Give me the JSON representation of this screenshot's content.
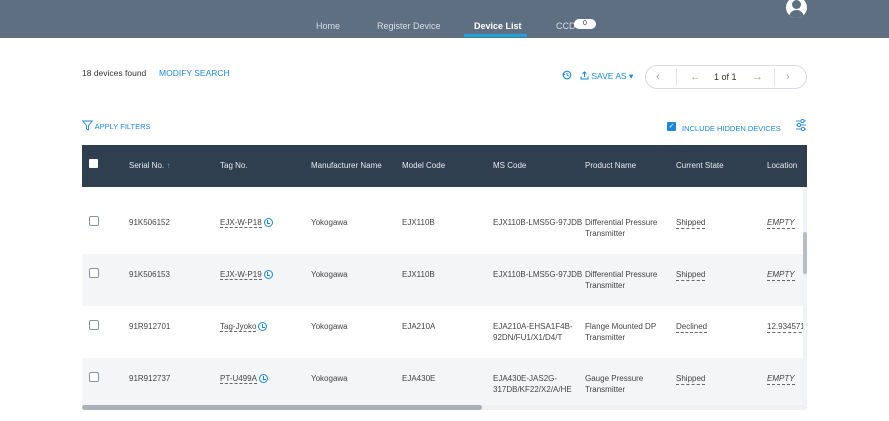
{
  "nav": {
    "home": "Home",
    "register": "Register Device",
    "device_list": "Device List",
    "ccd": "CCD",
    "ccd_count": "0"
  },
  "summary": {
    "count_text": "18 devices found",
    "modify_search": "MODIFY SEARCH"
  },
  "toolbar": {
    "save_as": "SAVE AS",
    "apply_filters": "APPLY FILTERS",
    "include_hidden": "INCLUDE HIDDEN DEVICES"
  },
  "pagination": {
    "label": "1 of 1"
  },
  "table": {
    "headers": {
      "serial": "Serial No.",
      "tag": "Tag No.",
      "manufacturer": "Manufacturer Name",
      "model": "Model Code",
      "ms": "MS Code",
      "product": "Product Name",
      "state": "Current State",
      "location": "Location"
    },
    "rows": [
      {
        "serial": "91K506152",
        "tag": "EJX-W-P18",
        "manufacturer": "Yokogawa",
        "model": "EJX110B",
        "ms": "EJX110B-LMS5G-97JDB",
        "product": "Differential Pressure Transmitter",
        "state": "Shipped",
        "location": "EMPTY"
      },
      {
        "serial": "91K506153",
        "tag": "EJX-W-P19",
        "manufacturer": "Yokogawa",
        "model": "EJX110B",
        "ms": "EJX110B-LMS5G-97JDB",
        "product": "Differential Pressure Transmitter",
        "state": "Shipped",
        "location": "EMPTY"
      },
      {
        "serial": "91R912701",
        "tag": "Tag-Jyoko",
        "manufacturer": "Yokogawa",
        "model": "EJA210A",
        "ms": "EJA210A-EHSA1F4B-92DN/FU1/X1/D4/T",
        "product": "Flange Mounted DP Transmitter",
        "state": "Declined",
        "location": "12.934571,"
      },
      {
        "serial": "91R912737",
        "tag": "PT-U499A",
        "manufacturer": "Yokogawa",
        "model": "EJA430E",
        "ms": "EJA430E-JAS2G-317DB/KF22/X2/A/HE",
        "product": "Gauge Pressure Transmitter",
        "state": "Shipped",
        "location": "EMPTY"
      }
    ]
  },
  "colors": {
    "topbar": "#5f6f82",
    "header": "#303f4f",
    "accent": "#1e88d6",
    "nav_underline": "#1fa2e0"
  },
  "icons": [
    "history-icon",
    "upload-icon",
    "filter-icon",
    "settings-sliders-icon",
    "user-avatar-icon",
    "clock-icon",
    "sort-arrow-up-icon"
  ]
}
